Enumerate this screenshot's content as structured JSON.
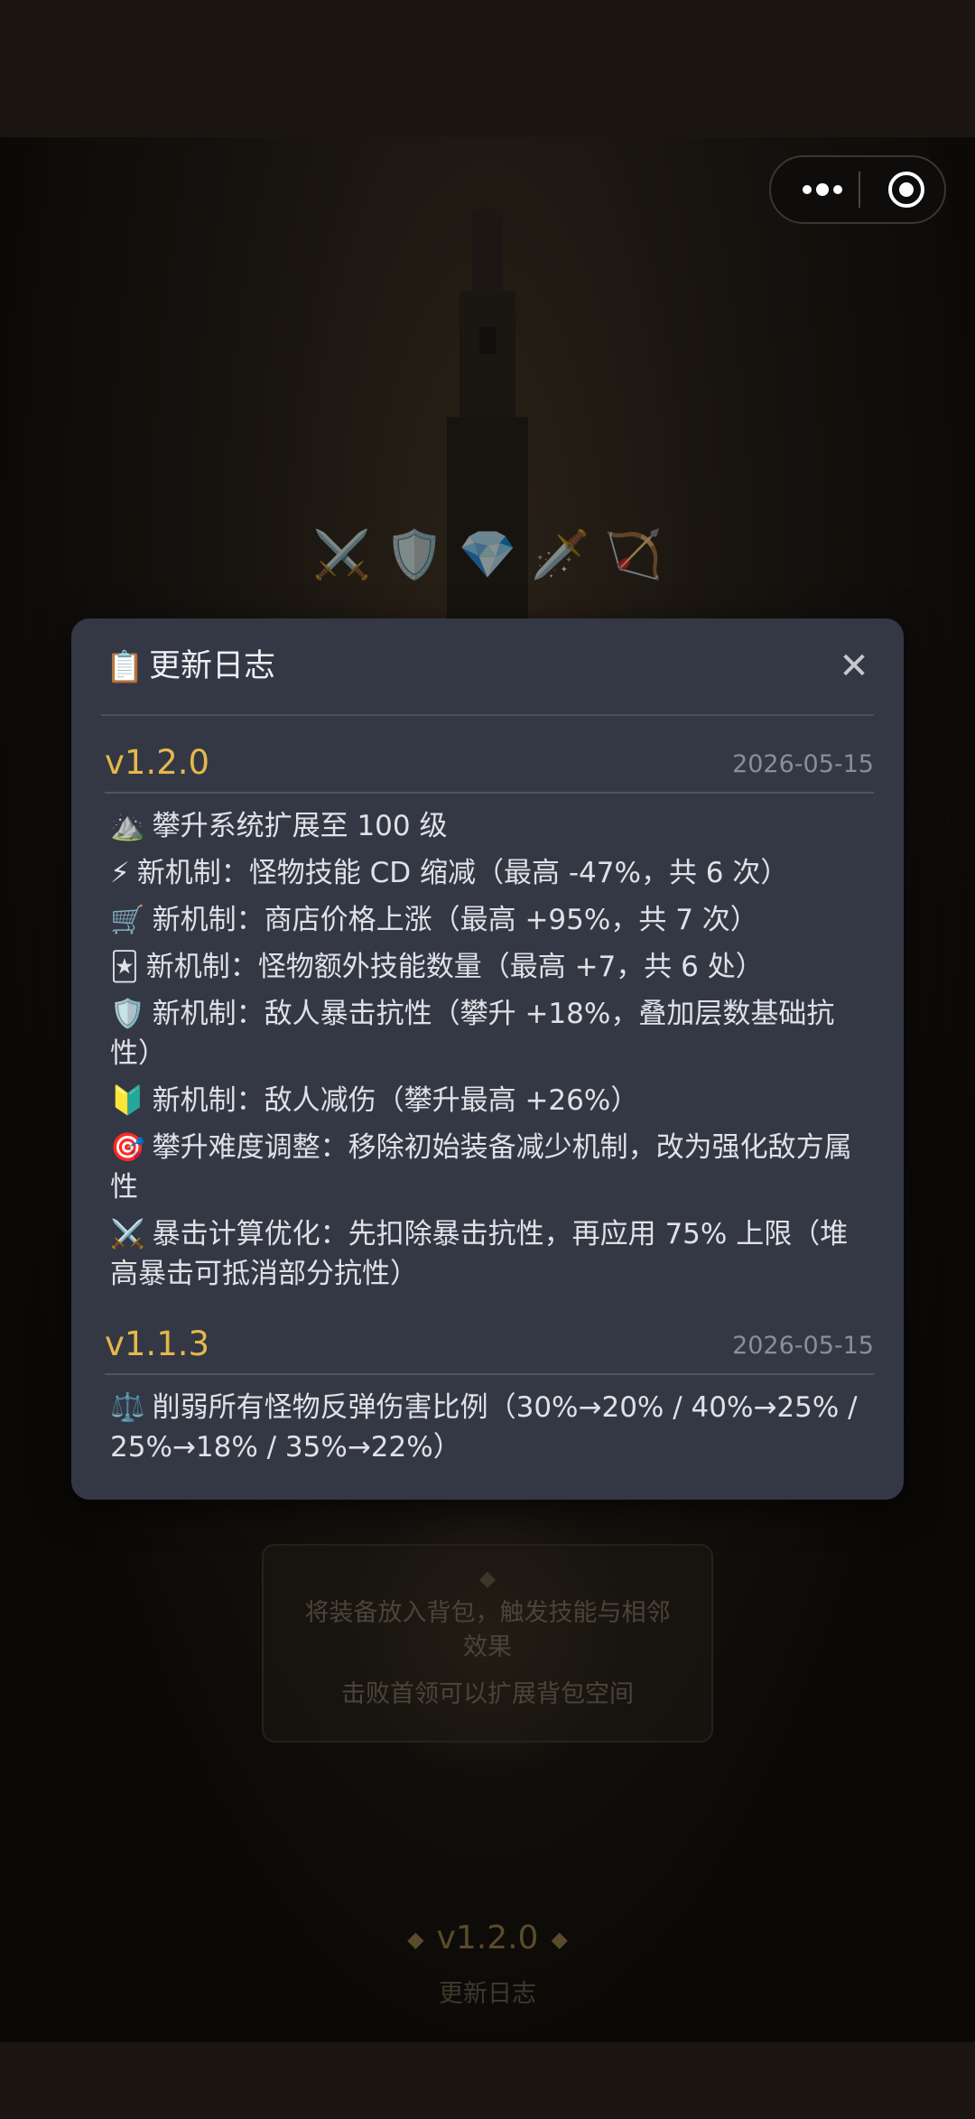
{
  "app": {
    "capsule": {
      "more_icon": "more-dots-icon",
      "close_icon": "target-circle-icon"
    }
  },
  "background": {
    "hero_icons": [
      "⚔️",
      "🛡️",
      "💎",
      "🗡️",
      "🏹"
    ],
    "hint": {
      "line1": "将装备放入背包，触发技能与相邻效果",
      "line2": "击败首领可以扩展背包空间"
    },
    "footer_version": "v1.2.0",
    "changelog_link": "更新日志"
  },
  "modal": {
    "icon": "📋",
    "title": "更新日志",
    "close_label": "✕",
    "releases": [
      {
        "version": "v1.2.0",
        "date": "2026-05-15",
        "items": [
          {
            "emoji": "⛰️",
            "text": "攀升系统扩展至 100 级"
          },
          {
            "emoji": "⚡",
            "text": "新机制：怪物技能 CD 缩减（最高 -47%，共 6 次）"
          },
          {
            "emoji": "🛒",
            "text": "新机制：商店价格上涨（最高 +95%，共 7 次）"
          },
          {
            "emoji": "🃏",
            "text": "新机制：怪物额外技能数量（最高 +7，共 6 处）"
          },
          {
            "emoji": "🛡️",
            "text": "新机制：敌人暴击抗性（攀升 +18%，叠加层数基础抗性）"
          },
          {
            "emoji": "🔰",
            "text": "新机制：敌人减伤（攀升最高 +26%）"
          },
          {
            "emoji": "🎯",
            "text": "攀升难度调整：移除初始装备减少机制，改为强化敌方属性"
          },
          {
            "emoji": "⚔️",
            "text": "暴击计算优化：先扣除暴击抗性，再应用 75% 上限（堆高暴击可抵消部分抗性）"
          }
        ]
      },
      {
        "version": "v1.1.3",
        "date": "2026-05-15",
        "items": [
          {
            "emoji": "⚖️",
            "text": "削弱所有怪物反弹伤害比例（30%→20% / 40%→25% / 25%→18% / 35%→22%）"
          }
        ]
      }
    ]
  }
}
